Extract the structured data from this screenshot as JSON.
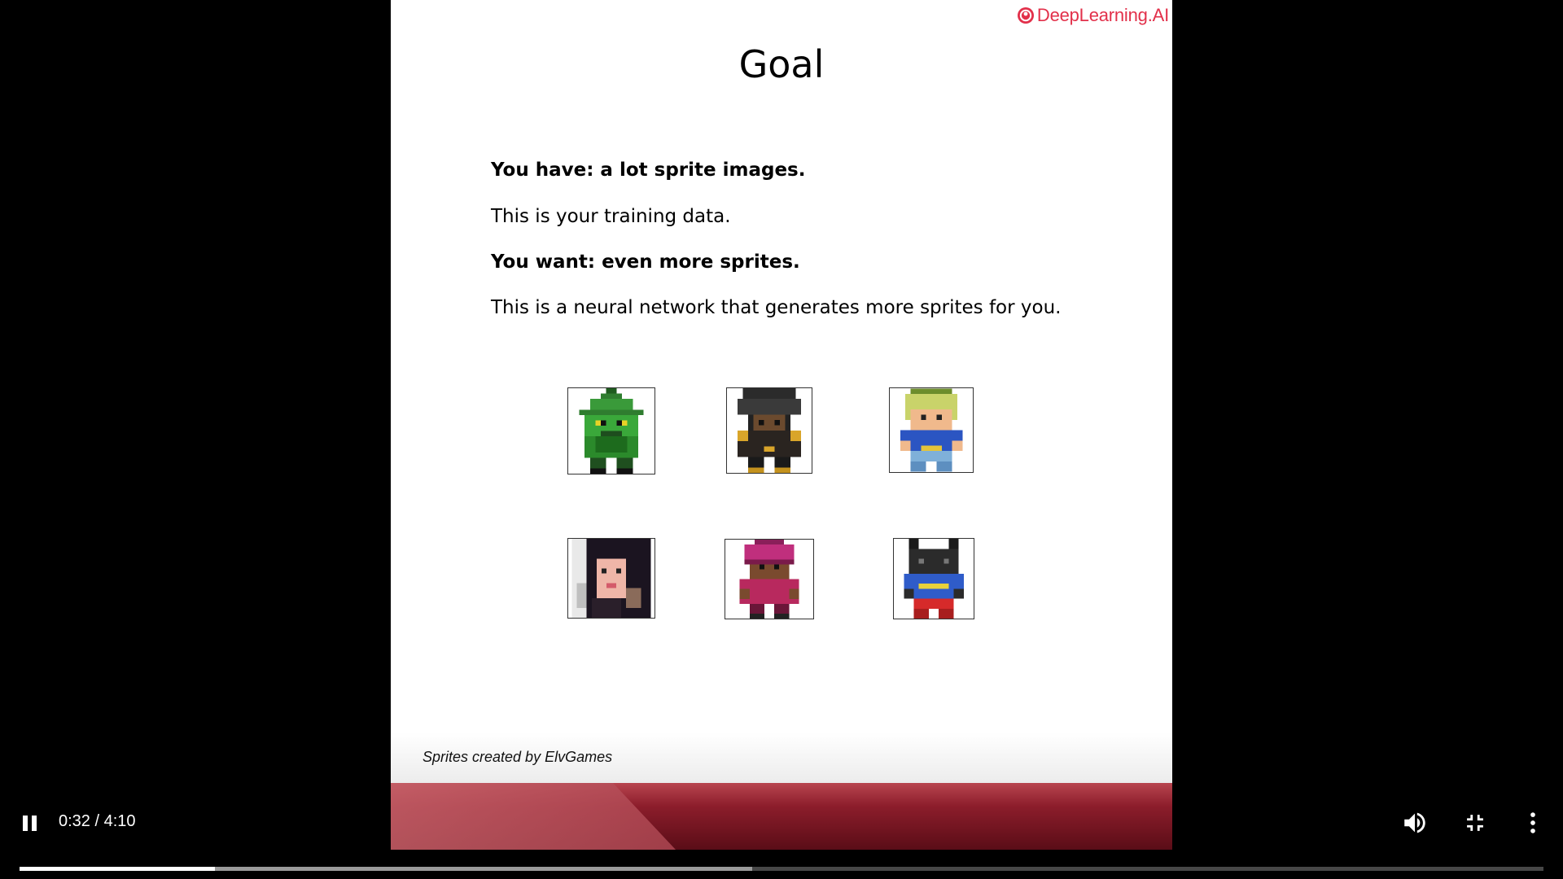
{
  "slide": {
    "logo_text": "DeepLearning.AI",
    "title": "Goal",
    "lines": [
      "You have: a lot sprite images.",
      "This is your training data.",
      "You want: even more sprites.",
      "This is a neural network that generates more sprites for you."
    ],
    "credit": "Sprites created by ElvGames"
  },
  "sprites": [
    "green-goblin-sprite",
    "dark-hooded-sprite",
    "blonde-blue-shirt-sprite",
    "woman-portrait-sprite",
    "magenta-hat-sprite",
    "black-cat-blue-suit-sprite"
  ],
  "player": {
    "time_current": "0:32",
    "time_total": "4:10",
    "time_separator": "/",
    "progress_fraction": 0.128,
    "buffered_fraction": 0.481,
    "state": "playing"
  },
  "icons": {
    "play_pause": "pause-icon",
    "volume": "volume-icon",
    "fullscreen": "exit-fullscreen-icon",
    "more": "more-vert-icon"
  },
  "colors": {
    "brand": "#e2304a",
    "band": "#8c1d2b"
  }
}
